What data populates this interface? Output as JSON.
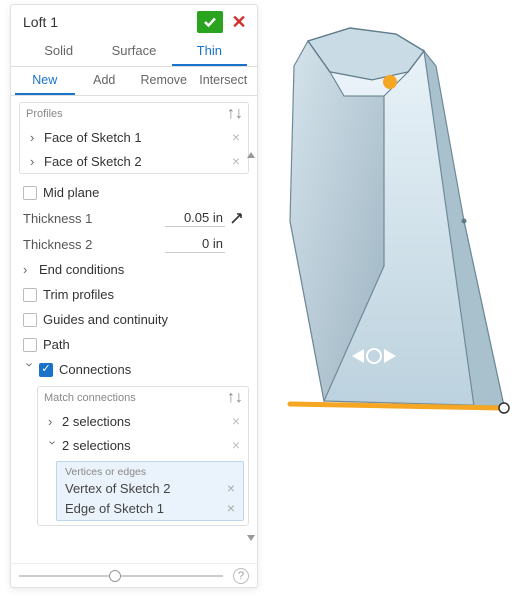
{
  "title": "Loft 1",
  "tabs_type": {
    "solid": "Solid",
    "surface": "Surface",
    "thin": "Thin",
    "active": "thin"
  },
  "tabs_bool": {
    "new": "New",
    "add": "Add",
    "remove": "Remove",
    "intersect": "Intersect",
    "active": "new"
  },
  "profiles": {
    "label": "Profiles",
    "items": [
      "Face of Sketch 1",
      "Face of Sketch 2"
    ]
  },
  "options": {
    "mid_plane": "Mid plane",
    "thickness1_label": "Thickness 1",
    "thickness1_value": "0.05 in",
    "thickness2_label": "Thickness 2",
    "thickness2_value": "0 in",
    "end_conditions": "End conditions",
    "trim_profiles": "Trim profiles",
    "guides": "Guides and continuity",
    "path": "Path",
    "connections": "Connections"
  },
  "connections": {
    "match_label": "Match connections",
    "group1": "2 selections",
    "group2": "2 selections",
    "sub_label": "Vertices or edges",
    "sub_items": [
      "Vertex of Sketch 2",
      "Edge of Sketch 1"
    ]
  }
}
